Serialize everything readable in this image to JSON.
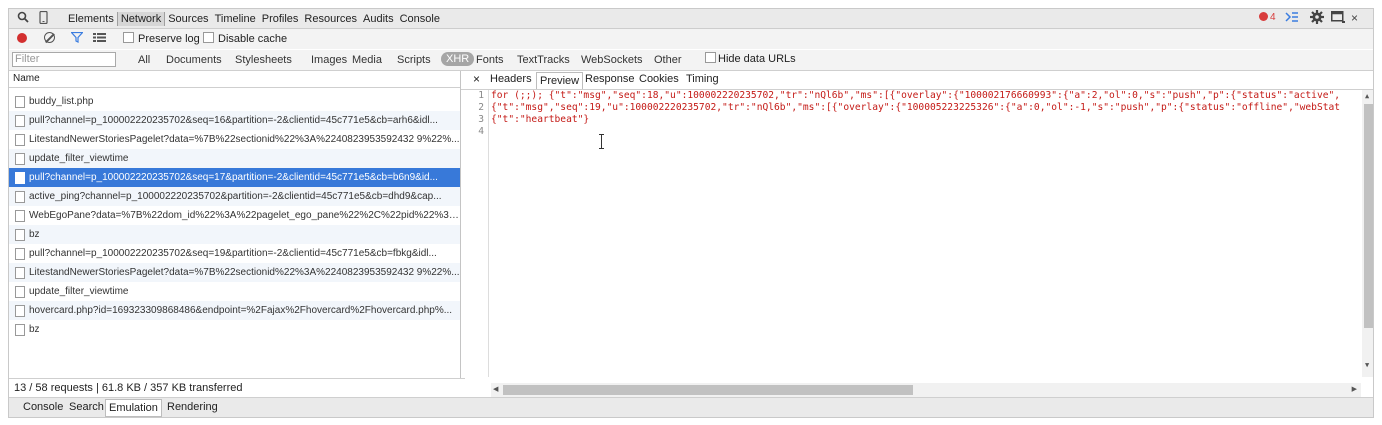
{
  "toolbar": {
    "tabs": [
      "Elements",
      "Network",
      "Sources",
      "Timeline",
      "Profiles",
      "Resources",
      "Audits",
      "Console"
    ],
    "selected_tab": "Network",
    "error_count": "4"
  },
  "controls": {
    "preserve_log": "Preserve log",
    "disable_cache": "Disable cache"
  },
  "filter": {
    "placeholder": "Filter",
    "types": [
      "All",
      "Documents",
      "Stylesheets",
      "Images",
      "Media",
      "Scripts",
      "XHR",
      "Fonts",
      "TextTracks",
      "WebSockets",
      "Other"
    ],
    "selected": "XHR",
    "hide_data_urls": "Hide data URLs"
  },
  "requests": {
    "column_name": "Name",
    "items": [
      "buddy_list.php",
      "pull?channel=p_100002220235702&seq=16&partition=-2&clientid=45c771e5&cb=arh6&idl...",
      "LitestandNewerStoriesPagelet?data=%7B%22sectionid%22%3A%2240823953592432 9%22%...",
      "update_filter_viewtime",
      "pull?channel=p_100002220235702&seq=17&partition=-2&clientid=45c771e5&cb=b6n9&id...",
      "active_ping?channel=p_100002220235702&partition=-2&clientid=45c771e5&cb=dhd9&cap...",
      "WebEgoPane?data=%7B%22dom_id%22%3A%22pagelet_ego_pane%22%2C%22pid%22%3A...",
      "bz",
      "pull?channel=p_100002220235702&seq=19&partition=-2&clientid=45c771e5&cb=fbkg&idl...",
      "LitestandNewerStoriesPagelet?data=%7B%22sectionid%22%3A%2240823953592432 9%22%...",
      "update_filter_viewtime",
      "hovercard.php?id=169323309868486&endpoint=%2Fajax%2Fhovercard%2Fhovercard.php%...",
      "bz"
    ],
    "selected_index": 4,
    "status": "13 / 58 requests  |  61.8 KB / 357 KB transferred"
  },
  "detail": {
    "tabs": [
      "Headers",
      "Preview",
      "Response",
      "Cookies",
      "Timing"
    ],
    "selected_tab": "Preview",
    "line_numbers": [
      "1",
      "2",
      "3",
      "4"
    ],
    "code_lines": [
      "for (;;); {\"t\":\"msg\",\"seq\":18,\"u\":100002220235702,\"tr\":\"nQl6b\",\"ms\":[{\"overlay\":{\"100002176660993\":{\"a\":2,\"ol\":0,\"s\":\"push\",\"p\":{\"status\":\"active\",",
      "{\"t\":\"msg\",\"seq\":19,\"u\":100002220235702,\"tr\":\"nQl6b\",\"ms\":[{\"overlay\":{\"100005223225326\":{\"a\":0,\"ol\":-1,\"s\":\"push\",\"p\":{\"status\":\"offline\",\"webStat",
      "{\"t\":\"heartbeat\"}",
      ""
    ]
  },
  "drawer": {
    "tabs": [
      "Console",
      "Search",
      "Emulation",
      "Rendering"
    ],
    "selected_tab": "Emulation"
  },
  "colors": {
    "selected_row": "#3879d9",
    "record": "#d32f2f",
    "code_text": "#c41a16"
  }
}
